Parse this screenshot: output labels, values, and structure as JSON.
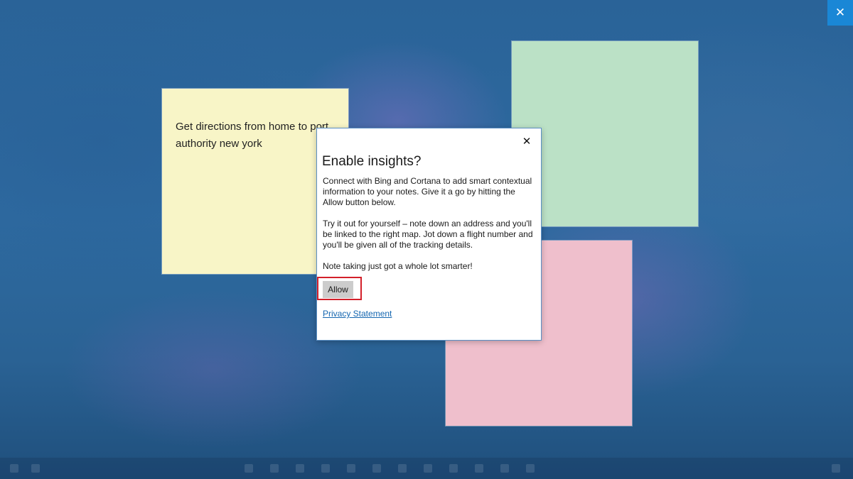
{
  "window": {
    "close_glyph": "✕"
  },
  "notes": [
    {
      "color": "#f8f5c7",
      "text": "Get directions from home to port authority new york"
    },
    {
      "color": "#bbe1c6",
      "text": ""
    },
    {
      "color": "#efbfcc",
      "text": ""
    }
  ],
  "dialog": {
    "title": "Enable insights?",
    "close_glyph": "✕",
    "paragraph_1": "Connect with Bing and Cortana to add smart contextual information to your notes. Give it a go by hitting the Allow button below.",
    "paragraph_2": "Try it out for yourself – note down an address and you'll be linked to the right map. Jot down a flight number and you'll be given all of the tracking details.",
    "paragraph_3": "Note taking just got a whole lot smarter!",
    "allow_label": "Allow",
    "privacy_label": "Privacy Statement",
    "highlight_color": "#d3202a"
  },
  "colors": {
    "accent": "#1a87d6",
    "link": "#1466b0"
  },
  "icons": {
    "close": "close-icon",
    "dialog_close": "close-icon"
  }
}
